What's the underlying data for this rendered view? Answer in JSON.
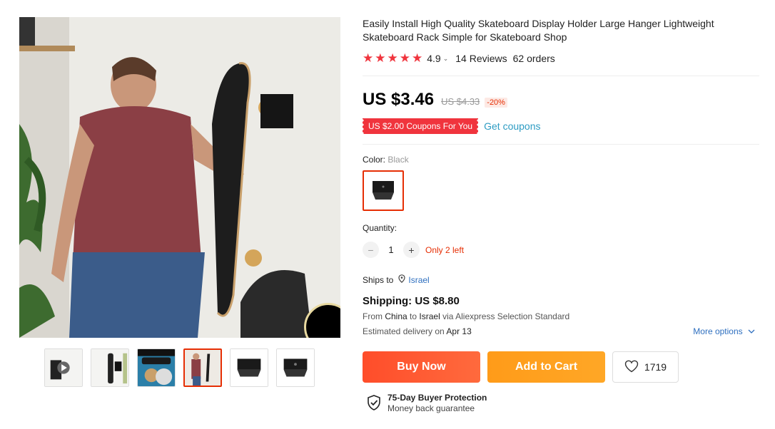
{
  "product": {
    "title": "Easily Install High Quality Skateboard Display Holder Large Hanger Lightweight Skateboard Rack Simple for Skateboard Shop",
    "rating": "4.9",
    "reviews": "14 Reviews",
    "orders": "62 orders"
  },
  "price": {
    "current": "US $3.46",
    "original": "US $4.33",
    "discount": "-20%"
  },
  "coupon": {
    "label": "US $2.00 Coupons For You",
    "link": "Get coupons"
  },
  "color": {
    "label": "Color:",
    "value": "Black"
  },
  "quantity": {
    "label": "Quantity:",
    "value": "1",
    "minus": "−",
    "plus": "+",
    "stock_note": "Only 2 left"
  },
  "shipping": {
    "ships_to_label": "Ships to",
    "country": "Israel",
    "cost": "Shipping: US $8.80",
    "from_prefix": "From",
    "from_country": "China",
    "to_word": "to",
    "to_country": "Israel",
    "via_text": "via Aliexpress Selection Standard",
    "delivery_prefix": "Estimated delivery on",
    "delivery_date": "Apr 13",
    "more_options": "More options"
  },
  "actions": {
    "buy_now": "Buy Now",
    "add_to_cart": "Add to Cart",
    "wishlist_count": "1719"
  },
  "protection": {
    "title": "75-Day Buyer Protection",
    "subtitle": "Money back guarantee"
  },
  "icons": {
    "star": "star-icon",
    "heart": "heart-icon",
    "shield": "shield-check-icon",
    "pin": "location-pin-icon",
    "chevron": "chevron-down-icon"
  },
  "colors": {
    "accent_red": "#f0343d",
    "buy_orange": "#ff5a2c",
    "cart_orange": "#ffa01e",
    "link_blue": "#2e6fbf"
  }
}
